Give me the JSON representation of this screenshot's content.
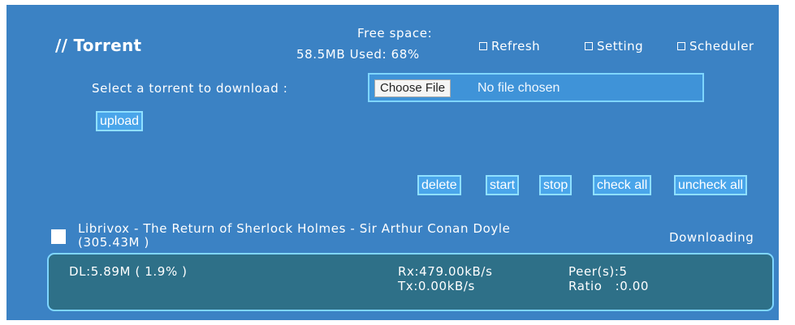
{
  "header": {
    "title": "// Torrent",
    "free_space_label": "Free space:",
    "free_space_value": "58.5MB  Used: 68%",
    "links": {
      "refresh": "Refresh",
      "setting": "Setting",
      "scheduler": "Scheduler"
    }
  },
  "upload_form": {
    "select_label": "Select a torrent to download :",
    "choose_file_label": "Choose File",
    "no_file_text": "No file chosen",
    "upload_label": "upload"
  },
  "actions": {
    "delete": "delete",
    "start": "start",
    "stop": "stop",
    "check_all": "check all",
    "uncheck_all": "uncheck all"
  },
  "torrent": {
    "name": "Librivox - The Return of Sherlock Holmes - Sir Arthur Conan Doyle",
    "size": "(305.43M )",
    "status": "Downloading",
    "downloaded": "DL:5.89M ( 1.9% )",
    "rx": "Rx:479.00kB/s",
    "tx": "Tx:0.00kB/s",
    "peers": "Peer(s):5",
    "ratio": "Ratio   :0.00"
  },
  "colors": {
    "panel_bg": "#3b82c4",
    "button_bg": "#49a5ea",
    "button_border": "#8fe0ff",
    "stats_bg": "#2e7088"
  }
}
